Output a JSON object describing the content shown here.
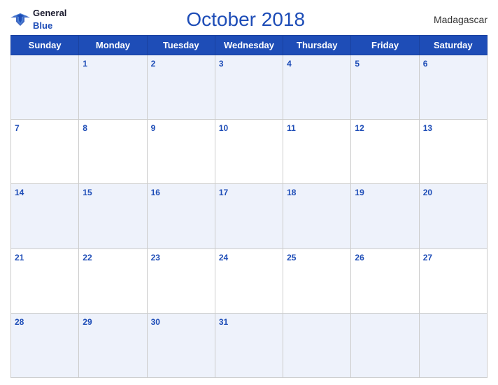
{
  "header": {
    "logo_general": "General",
    "logo_blue": "Blue",
    "title": "October 2018",
    "country": "Madagascar"
  },
  "days_of_week": [
    "Sunday",
    "Monday",
    "Tuesday",
    "Wednesday",
    "Thursday",
    "Friday",
    "Saturday"
  ],
  "weeks": [
    [
      null,
      1,
      2,
      3,
      4,
      5,
      6
    ],
    [
      7,
      8,
      9,
      10,
      11,
      12,
      13
    ],
    [
      14,
      15,
      16,
      17,
      18,
      19,
      20
    ],
    [
      21,
      22,
      23,
      24,
      25,
      26,
      27
    ],
    [
      28,
      29,
      30,
      31,
      null,
      null,
      null
    ]
  ]
}
